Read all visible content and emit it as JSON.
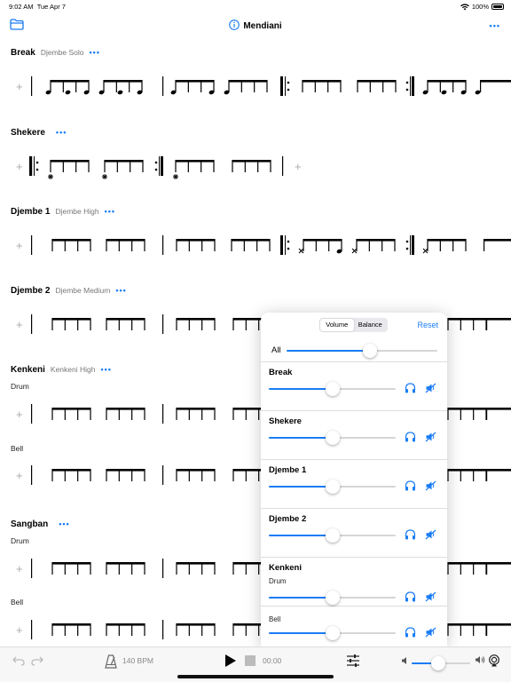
{
  "status_bar": {
    "time": "9:02 AM",
    "date": "Tue Apr 7",
    "battery": "100%"
  },
  "nav": {
    "title": "Mendiani",
    "more": "•••"
  },
  "instruments": [
    {
      "name": "Break",
      "subtitle": "Djembe Solo",
      "dots": "•••"
    },
    {
      "name": "Shekere",
      "subtitle": "",
      "dots": "•••"
    },
    {
      "name": "Djembe 1",
      "subtitle": "Djembe High",
      "dots": "•••"
    },
    {
      "name": "Djembe 2",
      "subtitle": "Djembe Medium",
      "dots": "•••"
    },
    {
      "name": "Kenkeni",
      "subtitle": "Kenkeni High",
      "dots": "•••",
      "parts": [
        "Drum",
        "Bell"
      ]
    },
    {
      "name": "Sangban",
      "subtitle": "",
      "dots": "•••",
      "parts": [
        "Drum",
        "Bell"
      ]
    }
  ],
  "add_symbol": "+",
  "mixer": {
    "tabs": [
      "Volume",
      "Balance"
    ],
    "active_tab": "Volume",
    "reset": "Reset",
    "all_label": "All",
    "all_level": 0.55,
    "channels": [
      {
        "name": "Break",
        "sub": "",
        "level": 0.5
      },
      {
        "name": "Shekere",
        "sub": "",
        "level": 0.5
      },
      {
        "name": "Djembe 1",
        "sub": "",
        "level": 0.5
      },
      {
        "name": "Djembe 2",
        "sub": "",
        "level": 0.5
      },
      {
        "name": "Kenkeni",
        "sub": "Drum",
        "level": 0.5
      },
      {
        "name": "",
        "sub": "Bell",
        "level": 0.5
      }
    ]
  },
  "transport": {
    "tempo": "140 BPM",
    "time": "00:00",
    "volume_level": 0.45
  }
}
